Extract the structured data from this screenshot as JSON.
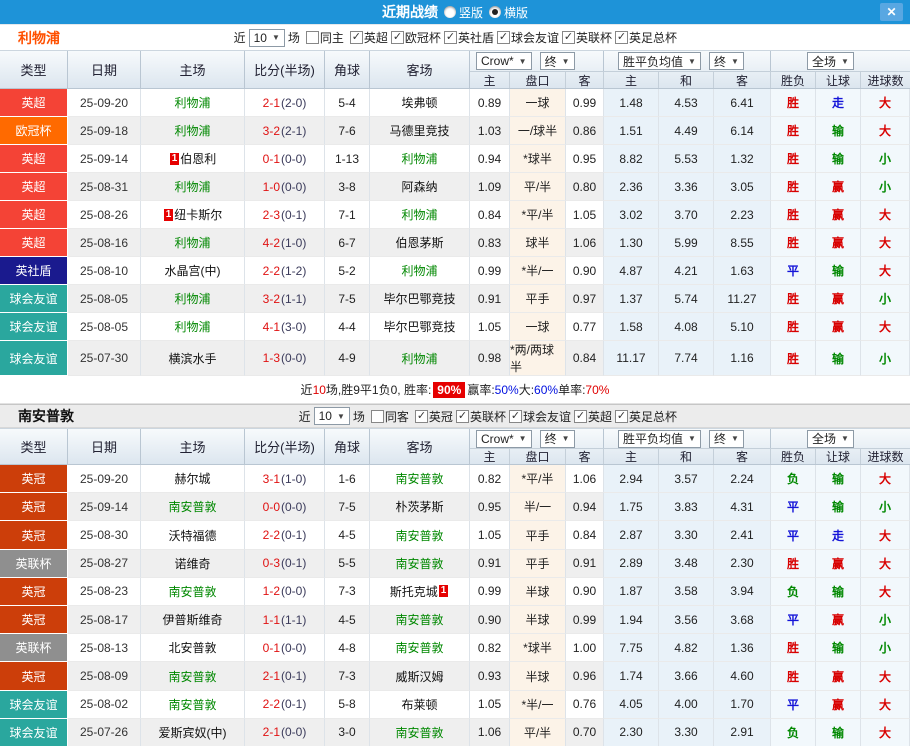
{
  "title_bar": {
    "title": "近期战绩",
    "vertical_label": "竖版",
    "horizontal_label": "横版"
  },
  "icons": {
    "close": "✕",
    "check": "✓",
    "arrow_down": "▼"
  },
  "header": {
    "type": "类型",
    "date": "日期",
    "home": "主场",
    "score": "比分(半场)",
    "corner": "角球",
    "away": "客场",
    "crow": "Crow*",
    "final": "终",
    "mean": "胜平负均值",
    "final2": "终",
    "full": "全场",
    "sub": [
      "主",
      "盘口",
      "客",
      "主",
      "和",
      "客",
      "胜负",
      "让球",
      "进球数"
    ]
  },
  "league_colors": {
    "英超": "#f44336",
    "欧冠杯": "#ff6a00",
    "英社盾": "#1a1a8e",
    "球会友谊": "#2aa79e",
    "英冠": "#cc3e0a",
    "英联杯": "#8f8f8f"
  },
  "result_colors": {
    "胜": "#d80000",
    "平": "#1414d8",
    "负": "#008800",
    "赢": "#d80000",
    "输": "#008800",
    "走": "#1414d8",
    "大": "#d80000",
    "小": "#008800"
  },
  "sections": [
    {
      "team": "利物浦",
      "filter": {
        "near_label": "近",
        "count": "10",
        "games_label": "场",
        "same_label": "同主",
        "same_checked": false,
        "leagues": [
          "英超",
          "欧冠杯",
          "英社盾",
          "球会友谊",
          "英联杯",
          "英足总杯"
        ]
      },
      "rows": [
        {
          "league": "英超",
          "date": "25-09-20",
          "home": "利物浦",
          "hf": true,
          "hb": "",
          "score": "2-1",
          "half": "(2-0)",
          "corner": "5-4",
          "away": "埃弗顿",
          "af": false,
          "ab": "",
          "o1": "0.89",
          "hcap": "一球",
          "o2": "0.99",
          "m1": "1.48",
          "m2": "4.53",
          "m3": "6.41",
          "wl": "胜",
          "rg": "走",
          "bs": "大"
        },
        {
          "league": "欧冠杯",
          "date": "25-09-18",
          "home": "利物浦",
          "hf": true,
          "hb": "",
          "score": "3-2",
          "half": "(2-1)",
          "corner": "7-6",
          "away": "马德里竞技",
          "af": false,
          "ab": "",
          "o1": "1.03",
          "hcap": "一/球半",
          "o2": "0.86",
          "m1": "1.51",
          "m2": "4.49",
          "m3": "6.14",
          "wl": "胜",
          "rg": "输",
          "bs": "大"
        },
        {
          "league": "英超",
          "date": "25-09-14",
          "home": "伯恩利",
          "hf": false,
          "hb": "1",
          "score": "0-1",
          "half": "(0-0)",
          "corner": "1-13",
          "away": "利物浦",
          "af": true,
          "ab": "",
          "o1": "0.94",
          "hcap": "*球半",
          "o2": "0.95",
          "m1": "8.82",
          "m2": "5.53",
          "m3": "1.32",
          "wl": "胜",
          "rg": "输",
          "bs": "小"
        },
        {
          "league": "英超",
          "date": "25-08-31",
          "home": "利物浦",
          "hf": true,
          "hb": "",
          "score": "1-0",
          "half": "(0-0)",
          "corner": "3-8",
          "away": "阿森纳",
          "af": false,
          "ab": "",
          "o1": "1.09",
          "hcap": "平/半",
          "o2": "0.80",
          "m1": "2.36",
          "m2": "3.36",
          "m3": "3.05",
          "wl": "胜",
          "rg": "赢",
          "bs": "小"
        },
        {
          "league": "英超",
          "date": "25-08-26",
          "home": "纽卡斯尔",
          "hf": false,
          "hb": "1",
          "score": "2-3",
          "half": "(0-1)",
          "corner": "7-1",
          "away": "利物浦",
          "af": true,
          "ab": "",
          "o1": "0.84",
          "hcap": "*平/半",
          "o2": "1.05",
          "m1": "3.02",
          "m2": "3.70",
          "m3": "2.23",
          "wl": "胜",
          "rg": "赢",
          "bs": "大"
        },
        {
          "league": "英超",
          "date": "25-08-16",
          "home": "利物浦",
          "hf": true,
          "hb": "",
          "score": "4-2",
          "half": "(1-0)",
          "corner": "6-7",
          "away": "伯恩茅斯",
          "af": false,
          "ab": "",
          "o1": "0.83",
          "hcap": "球半",
          "o2": "1.06",
          "m1": "1.30",
          "m2": "5.99",
          "m3": "8.55",
          "wl": "胜",
          "rg": "赢",
          "bs": "大"
        },
        {
          "league": "英社盾",
          "date": "25-08-10",
          "home": "水晶宫(中)",
          "hf": false,
          "hb": "",
          "score": "2-2",
          "half": "(1-2)",
          "corner": "5-2",
          "away": "利物浦",
          "af": true,
          "ab": "",
          "o1": "0.99",
          "hcap": "*半/一",
          "o2": "0.90",
          "m1": "4.87",
          "m2": "4.21",
          "m3": "1.63",
          "wl": "平",
          "rg": "输",
          "bs": "大"
        },
        {
          "league": "球会友谊",
          "date": "25-08-05",
          "home": "利物浦",
          "hf": true,
          "hb": "",
          "score": "3-2",
          "half": "(1-1)",
          "corner": "7-5",
          "away": "毕尔巴鄂竞技",
          "af": false,
          "ab": "",
          "o1": "0.91",
          "hcap": "平手",
          "o2": "0.97",
          "m1": "1.37",
          "m2": "5.74",
          "m3": "11.27",
          "wl": "胜",
          "rg": "赢",
          "bs": "小"
        },
        {
          "league": "球会友谊",
          "date": "25-08-05",
          "home": "利物浦",
          "hf": true,
          "hb": "",
          "score": "4-1",
          "half": "(3-0)",
          "corner": "4-4",
          "away": "毕尔巴鄂竞技",
          "af": false,
          "ab": "",
          "o1": "1.05",
          "hcap": "一球",
          "o2": "0.77",
          "m1": "1.58",
          "m2": "4.08",
          "m3": "5.10",
          "wl": "胜",
          "rg": "赢",
          "bs": "大"
        },
        {
          "league": "球会友谊",
          "date": "25-07-30",
          "home": "横滨水手",
          "hf": false,
          "hb": "",
          "score": "1-3",
          "half": "(0-0)",
          "corner": "4-9",
          "away": "利物浦",
          "af": true,
          "ab": "",
          "o1": "0.98",
          "hcap": "*两/两球半",
          "o2": "0.84",
          "m1": "11.17",
          "m2": "7.74",
          "m3": "1.16",
          "wl": "胜",
          "rg": "输",
          "bs": "小"
        }
      ],
      "summary": [
        {
          "t": "近",
          "s": "plain"
        },
        {
          "t": "10",
          "s": "red"
        },
        {
          "t": "场,胜9平1负0, 胜率: ",
          "s": "plain"
        },
        {
          "t": "90%",
          "s": "redbox"
        },
        {
          "t": " 赢率:",
          "s": "plain"
        },
        {
          "t": "50%",
          "s": "blue"
        },
        {
          "t": " 大:",
          "s": "plain"
        },
        {
          "t": "60%",
          "s": "blue"
        },
        {
          "t": " 单率:",
          "s": "plain"
        },
        {
          "t": "70%",
          "s": "red"
        }
      ]
    },
    {
      "team": "南安普敦",
      "filter": {
        "near_label": "近",
        "count": "10",
        "games_label": "场",
        "same_label": "同客",
        "same_checked": false,
        "leagues": [
          "英冠",
          "英联杯",
          "球会友谊",
          "英超",
          "英足总杯"
        ]
      },
      "rows": [
        {
          "league": "英冠",
          "date": "25-09-20",
          "home": "赫尔城",
          "hf": false,
          "hb": "",
          "score": "3-1",
          "half": "(1-0)",
          "corner": "1-6",
          "away": "南安普敦",
          "af": true,
          "ab": "",
          "o1": "0.82",
          "hcap": "*平/半",
          "o2": "1.06",
          "m1": "2.94",
          "m2": "3.57",
          "m3": "2.24",
          "wl": "负",
          "rg": "输",
          "bs": "大"
        },
        {
          "league": "英冠",
          "date": "25-09-14",
          "home": "南安普敦",
          "hf": true,
          "hb": "",
          "score": "0-0",
          "half": "(0-0)",
          "corner": "7-5",
          "away": "朴茨茅斯",
          "af": false,
          "ab": "",
          "o1": "0.95",
          "hcap": "半/一",
          "o2": "0.94",
          "m1": "1.75",
          "m2": "3.83",
          "m3": "4.31",
          "wl": "平",
          "rg": "输",
          "bs": "小"
        },
        {
          "league": "英冠",
          "date": "25-08-30",
          "home": "沃特福德",
          "hf": false,
          "hb": "",
          "score": "2-2",
          "half": "(0-1)",
          "corner": "4-5",
          "away": "南安普敦",
          "af": true,
          "ab": "",
          "o1": "1.05",
          "hcap": "平手",
          "o2": "0.84",
          "m1": "2.87",
          "m2": "3.30",
          "m3": "2.41",
          "wl": "平",
          "rg": "走",
          "bs": "大"
        },
        {
          "league": "英联杯",
          "date": "25-08-27",
          "home": "诺维奇",
          "hf": false,
          "hb": "",
          "score": "0-3",
          "half": "(0-1)",
          "corner": "5-5",
          "away": "南安普敦",
          "af": true,
          "ab": "",
          "o1": "0.91",
          "hcap": "平手",
          "o2": "0.91",
          "m1": "2.89",
          "m2": "3.48",
          "m3": "2.30",
          "wl": "胜",
          "rg": "赢",
          "bs": "大"
        },
        {
          "league": "英冠",
          "date": "25-08-23",
          "home": "南安普敦",
          "hf": true,
          "hb": "",
          "score": "1-2",
          "half": "(0-0)",
          "corner": "7-3",
          "away": "斯托克城",
          "af": false,
          "ab": "1",
          "o1": "0.99",
          "hcap": "半球",
          "o2": "0.90",
          "m1": "1.87",
          "m2": "3.58",
          "m3": "3.94",
          "wl": "负",
          "rg": "输",
          "bs": "大"
        },
        {
          "league": "英冠",
          "date": "25-08-17",
          "home": "伊普斯维奇",
          "hf": false,
          "hb": "",
          "score": "1-1",
          "half": "(1-1)",
          "corner": "4-5",
          "away": "南安普敦",
          "af": true,
          "ab": "",
          "o1": "0.90",
          "hcap": "半球",
          "o2": "0.99",
          "m1": "1.94",
          "m2": "3.56",
          "m3": "3.68",
          "wl": "平",
          "rg": "赢",
          "bs": "小"
        },
        {
          "league": "英联杯",
          "date": "25-08-13",
          "home": "北安普敦",
          "hf": false,
          "hb": "",
          "score": "0-1",
          "half": "(0-0)",
          "corner": "4-8",
          "away": "南安普敦",
          "af": true,
          "ab": "",
          "o1": "0.82",
          "hcap": "*球半",
          "o2": "1.00",
          "m1": "7.75",
          "m2": "4.82",
          "m3": "1.36",
          "wl": "胜",
          "rg": "输",
          "bs": "小"
        },
        {
          "league": "英冠",
          "date": "25-08-09",
          "home": "南安普敦",
          "hf": true,
          "hb": "",
          "score": "2-1",
          "half": "(0-1)",
          "corner": "7-3",
          "away": "威斯汉姆",
          "af": false,
          "ab": "",
          "o1": "0.93",
          "hcap": "半球",
          "o2": "0.96",
          "m1": "1.74",
          "m2": "3.66",
          "m3": "4.60",
          "wl": "胜",
          "rg": "赢",
          "bs": "大"
        },
        {
          "league": "球会友谊",
          "date": "25-08-02",
          "home": "南安普敦",
          "hf": true,
          "hb": "",
          "score": "2-2",
          "half": "(0-1)",
          "corner": "5-8",
          "away": "布莱顿",
          "af": false,
          "ab": "",
          "o1": "1.05",
          "hcap": "*半/一",
          "o2": "0.76",
          "m1": "4.05",
          "m2": "4.00",
          "m3": "1.70",
          "wl": "平",
          "rg": "赢",
          "bs": "大"
        },
        {
          "league": "球会友谊",
          "date": "25-07-26",
          "home": "爱斯宾奴(中)",
          "hf": false,
          "hb": "",
          "score": "2-1",
          "half": "(0-0)",
          "corner": "3-0",
          "away": "南安普敦",
          "af": true,
          "ab": "",
          "o1": "1.06",
          "hcap": "平/半",
          "o2": "0.70",
          "m1": "2.30",
          "m2": "3.30",
          "m3": "2.91",
          "wl": "负",
          "rg": "输",
          "bs": "大"
        }
      ],
      "summary": []
    }
  ]
}
